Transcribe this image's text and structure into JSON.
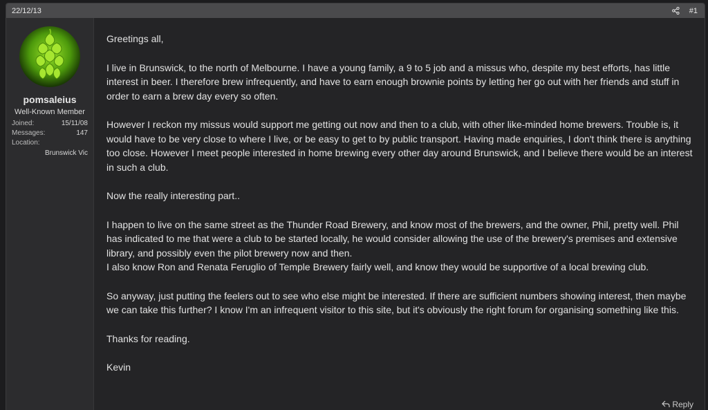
{
  "post": {
    "date": "22/12/13",
    "number": "#1",
    "share_icon": "share-icon",
    "reply_label": "Reply",
    "reply_icon": "reply-icon"
  },
  "user": {
    "avatar": "hop-cone-avatar",
    "name": "pomsaleius",
    "title": "Well-Known Member",
    "stats": [
      {
        "label": "Joined:",
        "value": "15/11/08"
      },
      {
        "label": "Messages:",
        "value": "147"
      },
      {
        "label": "Location:",
        "value": ""
      }
    ],
    "location": "Brunswick Vic"
  },
  "message": {
    "p1": "Greetings all,",
    "p2": "I live in Brunswick, to the north of Melbourne. I have a young family, a 9 to 5 job and a missus who, despite my best efforts, has little interest in beer. I therefore brew infrequently, and have to earn enough brownie points by letting her go out with her friends and stuff in order to earn a brew day every so often.",
    "p3": "However I reckon my missus would support me getting out now and then to a club, with other like-minded home brewers. Trouble is, it would have to be very close to where I live, or be easy to get to by public transport. Having made enquiries, I don't think there is anything too close. However I meet people interested in home brewing every other day around Brunswick, and I believe there would be an interest in such a club.",
    "p4": "Now the really interesting part..",
    "p5a": "I happen to live on the same street as the Thunder Road Brewery, and know most of the brewers, and the owner, Phil, pretty well. Phil has indicated to me that were a club to be started locally, he would consider allowing the use of the brewery's premises and extensive library, and possibly even the pilot brewery now and then.",
    "p5b": "I also know Ron and Renata Feruglio of Temple Brewery fairly well, and know they would be supportive of a local brewing club.",
    "p6": "So anyway, just putting the feelers out to see who else might be interested. If there are sufficient numbers showing interest, then maybe we can take this further? I know I'm an infrequent visitor to this site, but it's obviously the right forum for organising something like this.",
    "p7": "Thanks for reading.",
    "p8": "Kevin"
  }
}
